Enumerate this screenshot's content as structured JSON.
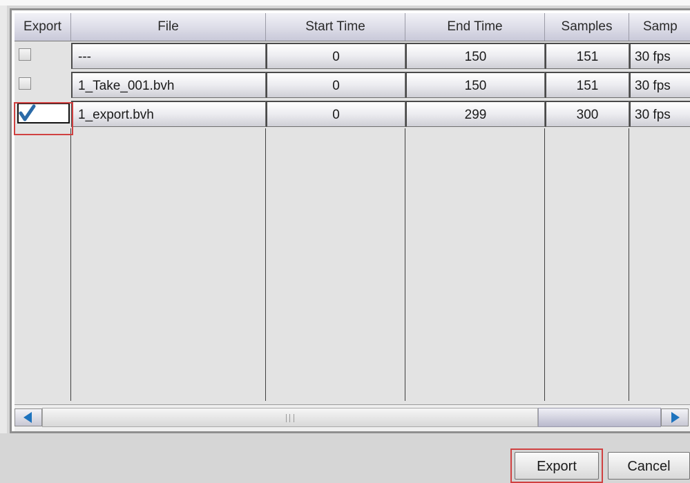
{
  "table": {
    "columns": [
      "Export",
      "File",
      "Start Time",
      "End Time",
      "Samples",
      "Samp"
    ],
    "rows": [
      {
        "export_checked": false,
        "file": "---",
        "start_time": "0",
        "end_time": "150",
        "samples": "151",
        "sample_rate": "30 fps"
      },
      {
        "export_checked": false,
        "file": "1_Take_001.bvh",
        "start_time": "0",
        "end_time": "150",
        "samples": "151",
        "sample_rate": "30 fps"
      },
      {
        "export_checked": true,
        "file": "1_export.bvh",
        "start_time": "0",
        "end_time": "299",
        "samples": "300",
        "sample_rate": "30 fps"
      }
    ]
  },
  "scrollbar": {
    "left_icon": "arrow-left-icon",
    "right_icon": "arrow-right-icon",
    "grip_icon": "scroll-grip-icon"
  },
  "buttons": {
    "export_label": "Export",
    "cancel_label": "Cancel"
  },
  "colors": {
    "highlight": "#d04040",
    "check": "#2a6aa8"
  }
}
